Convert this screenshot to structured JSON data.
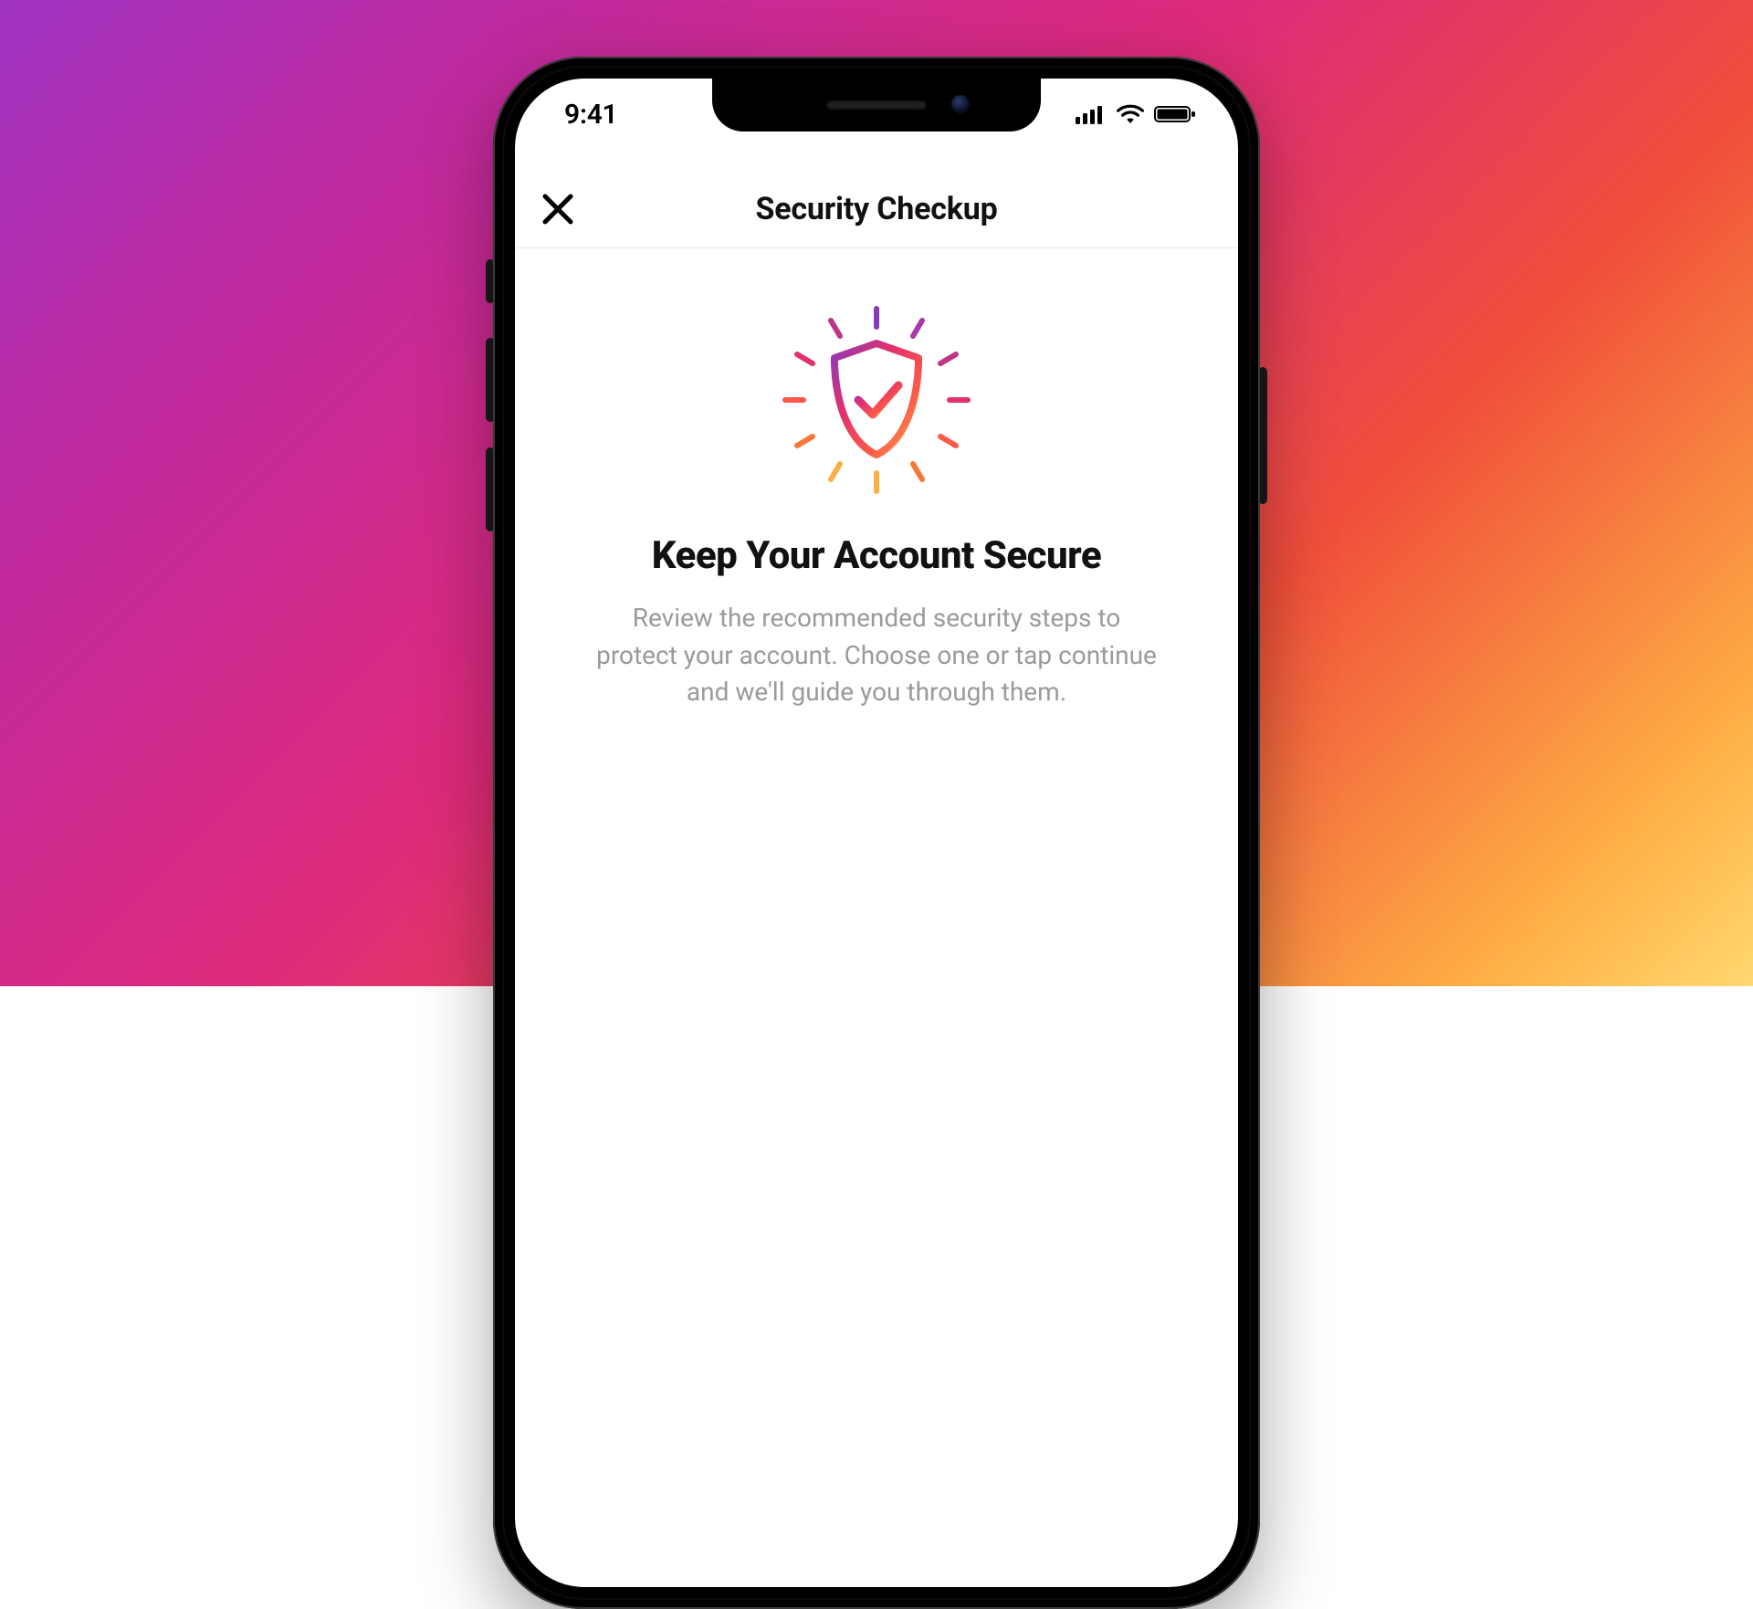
{
  "status_bar": {
    "time": "9:41"
  },
  "header": {
    "title": "Security Checkup"
  },
  "content": {
    "headline": "Keep Your Account Secure",
    "subtext": "Review the recommended security steps to protect your account. Choose one or tap continue and we'll guide you through them."
  },
  "colors": {
    "gradient_start": "#a033c2",
    "gradient_mid": "#dd2a7b",
    "gradient_end": "#feb045"
  }
}
